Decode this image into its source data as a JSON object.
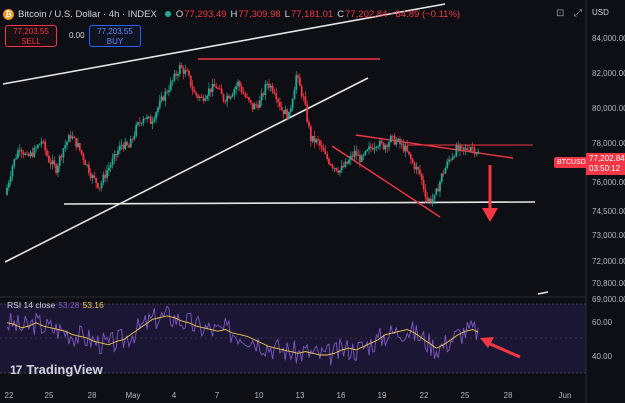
{
  "header": {
    "symbol_icon": "bitcoin-icon",
    "symbol_glyph": "₿",
    "title": "Bitcoin / U.S. Dollar · 4h · INDEX",
    "ohlc": [
      {
        "label": "O",
        "value": "77,293.49"
      },
      {
        "label": "H",
        "value": "77,309.98"
      },
      {
        "label": "L",
        "value": "77,181.01"
      },
      {
        "label": "C",
        "value": "77,202.84 −84.89 (−0.11%)"
      }
    ]
  },
  "trade": {
    "sell_price": "77,203.55",
    "sell_label": "SELL",
    "buy_price": "77,203.55",
    "buy_label": "BUY",
    "spread": "0.00"
  },
  "axis": {
    "currency": "USD",
    "price_labels": [
      "84,000.00",
      "82,000.00",
      "80,000.00",
      "78,000.00",
      "76,000.00",
      "74,500.00",
      "73,000.00",
      "72,000.00",
      "70,800.00",
      "69,000.00"
    ],
    "rsi_labels": [
      "60.00",
      "40.00"
    ],
    "time_labels": [
      "22",
      "25",
      "28",
      "May",
      "4",
      "7",
      "10",
      "13",
      "16",
      "19",
      "22",
      "25",
      "28",
      "Jun"
    ]
  },
  "last_price": {
    "ticker": "BTCUSD",
    "price": "77,202.84",
    "countdown": "03:50:12"
  },
  "rsi": {
    "label": "RSI 14 close",
    "value1": "53.28",
    "value2": "53.16"
  },
  "brand": {
    "logo_glyph": "17",
    "name": "TradingView"
  },
  "colors": {
    "background": "#0e0f14",
    "up": "#22ab94",
    "down": "#f23645",
    "rsi_line": "#7e57c2",
    "rsi_ma": "#f0c94a",
    "annotation_red": "#f23645"
  },
  "chart_data": {
    "type": "candlestick",
    "timeframe": "4h",
    "y_unit": "USD",
    "price_path": [
      74800,
      76500,
      77600,
      76900,
      77300,
      77900,
      76800,
      76300,
      77500,
      78200,
      77600,
      76700,
      75800,
      75300,
      76200,
      76900,
      77700,
      77500,
      78600,
      79300,
      79000,
      79800,
      80600,
      81300,
      82100,
      81700,
      80600,
      80300,
      80800,
      81000,
      80300,
      80600,
      81200,
      80400,
      79800,
      80100,
      81200,
      80800,
      79700,
      79300,
      81600,
      80300,
      78000,
      77800,
      77000,
      76500,
      76200,
      76600,
      77200,
      76800,
      77400,
      77800,
      77600,
      78000,
      77800,
      77400,
      76600,
      76000,
      74500,
      74600,
      75900,
      76800,
      77400,
      77300,
      77600,
      77200
    ],
    "rsi_path": [
      59,
      58,
      56,
      57,
      59,
      57,
      56,
      55,
      54,
      52,
      51,
      50,
      48,
      47,
      46,
      48,
      49,
      52,
      55,
      58,
      61,
      62,
      63,
      62,
      60,
      59,
      57,
      56,
      55,
      54,
      55,
      53,
      52,
      51,
      49,
      47,
      45,
      44,
      43,
      42,
      41,
      42,
      41,
      40,
      40,
      41,
      43,
      44,
      43,
      45,
      47,
      49,
      52,
      53,
      54,
      55,
      53,
      50,
      47,
      44,
      46,
      49,
      52,
      54,
      55,
      53
    ],
    "annotations": [
      {
        "type": "horizontal_line",
        "price": 74900
      },
      {
        "type": "red_line",
        "price": 83200
      },
      {
        "type": "descending_channel_top",
        "from": 78800,
        "to": 77600
      },
      {
        "type": "descending_channel_bottom",
        "from": 78000,
        "to": 74300
      },
      {
        "type": "down_arrow",
        "from": 77000,
        "to": 74000
      }
    ]
  }
}
